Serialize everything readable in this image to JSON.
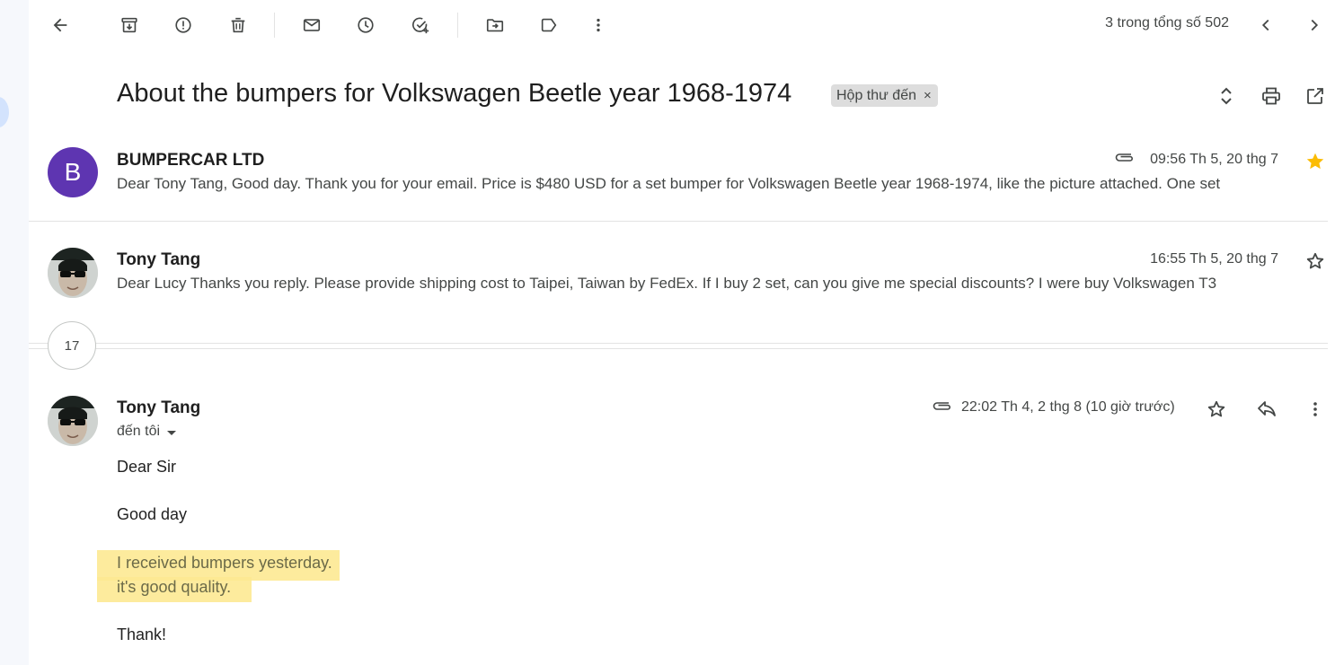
{
  "toolbar": {
    "back_icon": "arrow-left-icon",
    "archive_icon": "archive-icon",
    "spam_icon": "report-spam-icon",
    "delete_icon": "trash-icon",
    "unread_icon": "mail-icon",
    "snooze_icon": "clock-icon",
    "task_icon": "add-task-icon",
    "move_icon": "move-to-folder-icon",
    "label_icon": "label-icon",
    "more_icon": "more-vert-icon",
    "pager_text": "3 trong tổng số 502",
    "prev_icon": "chevron-left-icon",
    "next_icon": "chevron-right-icon"
  },
  "thread": {
    "subject": "About the bumpers for Volkswagen Beetle year 1968-1974",
    "label": "Hộp thư đến",
    "label_remove": "×"
  },
  "messages": [
    {
      "avatar_letter": "B",
      "sender": "BUMPERCAR LTD",
      "date": "09:56 Th 5, 20 thg 7",
      "has_attachment": true,
      "starred": true,
      "snippet": "Dear Tony Tang, Good day. Thank you for your email. Price is $480 USD for a set bumper for Volkswagen Beetle year 1968-1974, like the picture attached. One set"
    },
    {
      "sender": "Tony Tang",
      "date": "16:55 Th 5, 20 thg 7",
      "has_attachment": false,
      "starred": false,
      "snippet": "Dear Lucy Thanks you reply. Please provide shipping cost to Taipei, Taiwan by FedEx. If I buy 2 set, can you give me special discounts? I were buy Volkswagen T3"
    }
  ],
  "collapsed_count": "17",
  "open_message": {
    "sender": "Tony Tang",
    "to_line": "đến tôi",
    "date": "22:02 Th 4, 2 thg 8 (10 giờ trước)",
    "has_attachment": true,
    "body": {
      "greeting": "Dear Sir",
      "line2": "Good day",
      "highlight1": "I received bumpers yesterday.",
      "highlight2": "it's  good quality.",
      "closing": "Thank!"
    }
  },
  "colors": {
    "avatar_b": "#5e35b1",
    "star_filled": "#fbbc04",
    "highlight": "#fde992"
  }
}
